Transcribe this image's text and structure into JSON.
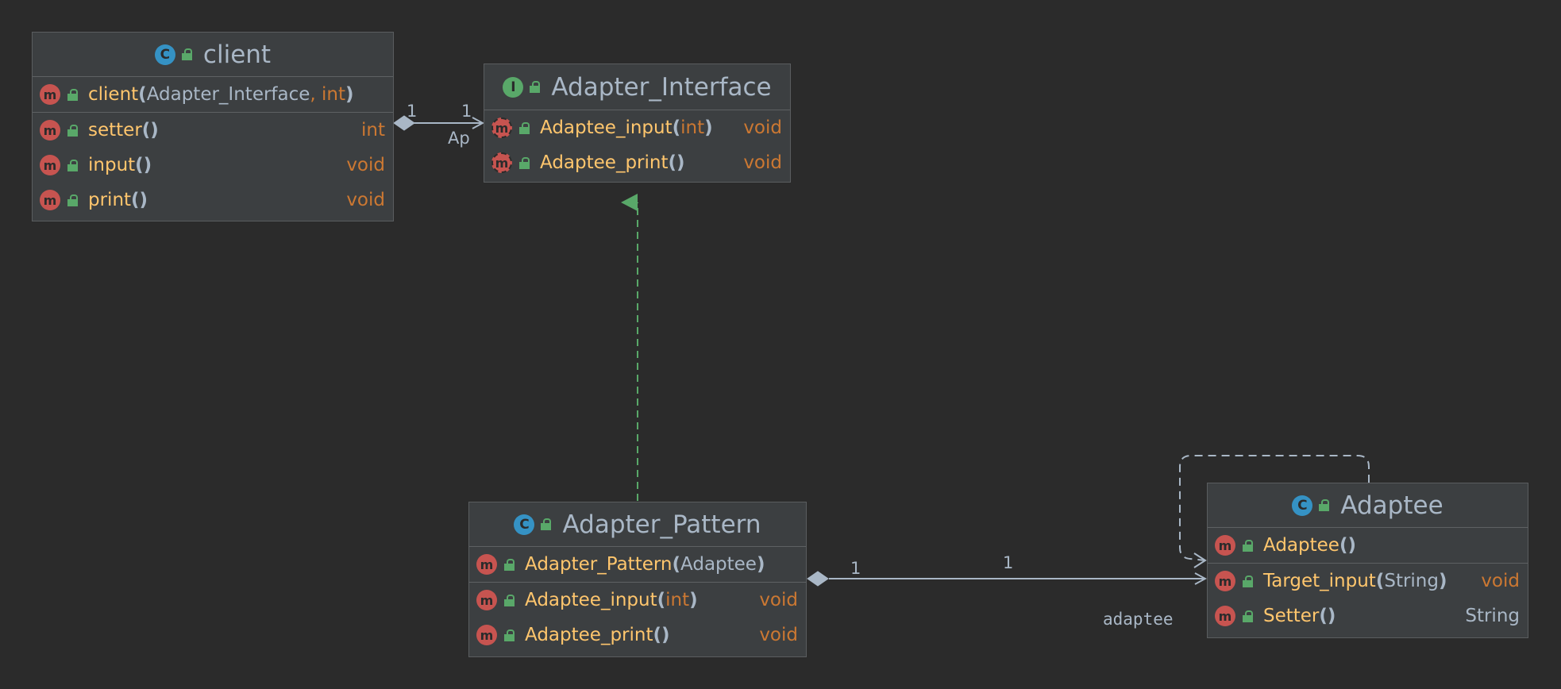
{
  "diagram": {
    "classes": {
      "client": {
        "kind_badge": "C",
        "name": "client",
        "constructor": {
          "name": "client",
          "param1": "Adapter_Interface",
          "comma": ",",
          "param2": "int"
        },
        "methods": [
          {
            "name": "setter",
            "returns": "int"
          },
          {
            "name": "input",
            "returns": "void"
          },
          {
            "name": "print",
            "returns": "void"
          }
        ]
      },
      "adapter_interface": {
        "kind_badge": "I",
        "name": "Adapter_Interface",
        "methods": [
          {
            "name": "Adaptee_input",
            "param": "int",
            "returns": "void"
          },
          {
            "name": "Adaptee_print",
            "returns": "void"
          }
        ]
      },
      "adapter_pattern": {
        "kind_badge": "C",
        "name": "Adapter_Pattern",
        "constructor": {
          "name": "Adapter_Pattern",
          "param": "Adaptee"
        },
        "methods": [
          {
            "name": "Adaptee_input",
            "param": "int",
            "returns": "void"
          },
          {
            "name": "Adaptee_print",
            "returns": "void"
          }
        ]
      },
      "adaptee": {
        "kind_badge": "C",
        "name": "Adaptee",
        "constructor": {
          "name": "Adaptee"
        },
        "methods": [
          {
            "name": "Target_input",
            "param": "String",
            "returns": "void"
          },
          {
            "name": "Setter",
            "returns": "String"
          }
        ]
      }
    },
    "method_badge": "m",
    "paren_open": "(",
    "paren_close": ")",
    "empty_parens": "()",
    "edges": {
      "client_to_interface": {
        "source_mult": "1",
        "target_mult": "1",
        "role": "Ap"
      },
      "pattern_to_adaptee": {
        "source_mult": "1",
        "target_mult": "1",
        "role": "adaptee"
      }
    },
    "colors": {
      "background": "#2b2b2b",
      "node_fill": "#3c3f41",
      "method_name": "#ffc66d",
      "primitive_type": "#cc7832",
      "text": "#a9b7c6",
      "class_icon": "#3592c4",
      "interface_icon": "#59a869",
      "method_icon": "#c75450",
      "realization_edge": "#59a869",
      "association_edge": "#a9b7c6"
    }
  }
}
